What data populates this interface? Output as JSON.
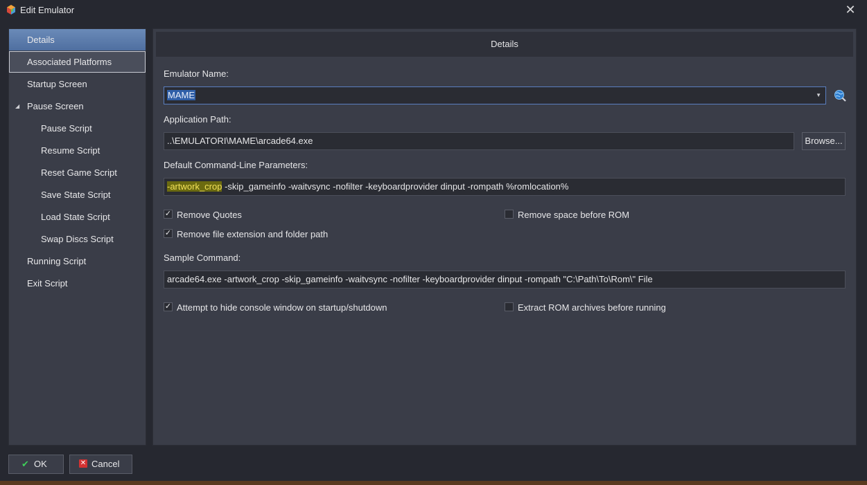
{
  "window": {
    "title": "Edit Emulator",
    "close_glyph": "✕"
  },
  "nav": {
    "items": [
      {
        "label": "Details",
        "level": 0,
        "state": "selected"
      },
      {
        "label": "Associated Platforms",
        "level": 0,
        "state": "hover"
      },
      {
        "label": "Startup Screen",
        "level": 0
      },
      {
        "label": "Pause Screen",
        "level": 0,
        "expanded": true
      },
      {
        "label": "Pause Script",
        "level": 1
      },
      {
        "label": "Resume Script",
        "level": 1
      },
      {
        "label": "Reset Game Script",
        "level": 1
      },
      {
        "label": "Save State Script",
        "level": 1
      },
      {
        "label": "Load State Script",
        "level": 1
      },
      {
        "label": "Swap Discs Script",
        "level": 1
      },
      {
        "label": "Running Script",
        "level": 0
      },
      {
        "label": "Exit Script",
        "level": 0
      }
    ]
  },
  "main": {
    "header": "Details",
    "emulator_name_label": "Emulator Name:",
    "emulator_name_value": "MAME",
    "app_path_label": "Application Path:",
    "app_path_value": "..\\EMULATORI\\MAME\\arcade64.exe",
    "browse_label": "Browse...",
    "params_label": "Default Command-Line Parameters:",
    "params_highlight": "-artwork_crop",
    "params_rest": " -skip_gameinfo -waitvsync -nofilter -keyboardprovider dinput -rompath %romlocation%",
    "remove_quotes_label": "Remove Quotes",
    "remove_quotes_checked": true,
    "remove_space_label": "Remove space before ROM",
    "remove_space_checked": false,
    "remove_ext_label": "Remove file extension and folder path",
    "remove_ext_checked": true,
    "sample_label": "Sample Command:",
    "sample_value": "arcade64.exe -artwork_crop -skip_gameinfo -waitvsync -nofilter -keyboardprovider dinput -rompath \"C:\\Path\\To\\Rom\\\" File",
    "hide_console_label": "Attempt to hide console window on startup/shutdown",
    "hide_console_checked": true,
    "extract_label": "Extract ROM archives before running",
    "extract_checked": false
  },
  "footer": {
    "ok_label": "OK",
    "cancel_label": "Cancel"
  },
  "colors": {
    "background": "#262830",
    "panel": "#3a3d48",
    "accent": "#5a7fc0",
    "highlight": "#6b6a10"
  },
  "icons": {
    "app": "launchbox-cube-icon",
    "search": "globe-search-icon",
    "ok": "check-icon",
    "cancel": "x-icon"
  }
}
